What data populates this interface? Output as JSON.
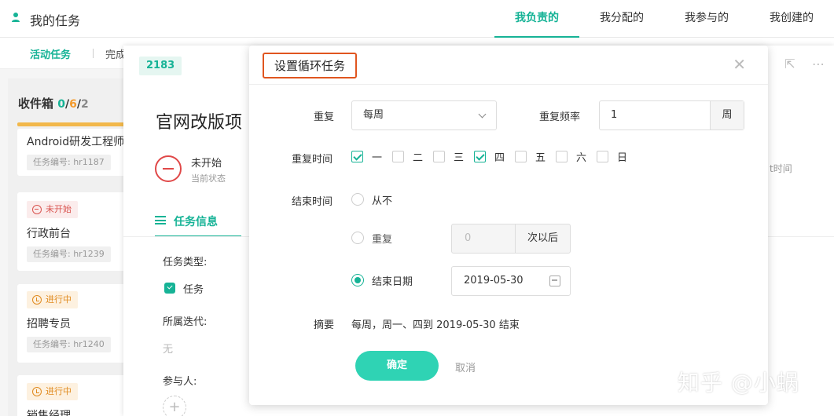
{
  "topbar": {
    "title": "我的任务",
    "nav": [
      "我负责的",
      "我分配的",
      "我参与的",
      "我创建的"
    ]
  },
  "subtabs": {
    "active": "活动任务",
    "second": "完成"
  },
  "inbox": {
    "title": "收件箱",
    "count_a": "0",
    "count_b": "6",
    "count_c": "2",
    "cards": [
      {
        "name": "Android研发工程师",
        "code": "任务编号: hr1187"
      },
      {
        "status": "未开始",
        "name": "行政前台",
        "code": "任务编号: hr1239"
      },
      {
        "status": "进行中",
        "name": "招聘专员",
        "code": "任务编号: hr1240"
      },
      {
        "status": "进行中",
        "name": "销售经理"
      }
    ]
  },
  "detail": {
    "task_id": "2183",
    "title": "官网改版项",
    "status": "未开始",
    "status_sub": "当前状态",
    "info_tab": "任务信息",
    "type_label": "任务类型:",
    "type_value": "任务",
    "iteration_label": "所属迭代:",
    "iteration_value": "无",
    "participants_label": "参与人:",
    "time_fragment": "t时间"
  },
  "modal": {
    "title": "设置循环任务",
    "repeat_label": "重复",
    "repeat_value": "每周",
    "freq_label": "重复频率",
    "freq_value": "1",
    "freq_unit": "周",
    "repeat_time_label": "重复时间",
    "days": [
      {
        "label": "一",
        "checked": true
      },
      {
        "label": "二",
        "checked": false
      },
      {
        "label": "三",
        "checked": false
      },
      {
        "label": "四",
        "checked": true
      },
      {
        "label": "五",
        "checked": false
      },
      {
        "label": "六",
        "checked": false
      },
      {
        "label": "日",
        "checked": false
      }
    ],
    "end_time_label": "结束时间",
    "end_never": "从不",
    "end_repeat": "重复",
    "end_repeat_count": "0",
    "end_repeat_unit": "次以后",
    "end_date_label": "结束日期",
    "end_date_value": "2019-05-30",
    "summary_label": "摘要",
    "summary_value": "每周，周一、四到 2019-05-30 结束",
    "ok": "确定",
    "cancel": "取消"
  },
  "watermark": "知乎 @小蜗",
  "colors": {
    "accent": "#16b396",
    "button": "#2fd3b4",
    "highlight_border": "#e0551f"
  }
}
